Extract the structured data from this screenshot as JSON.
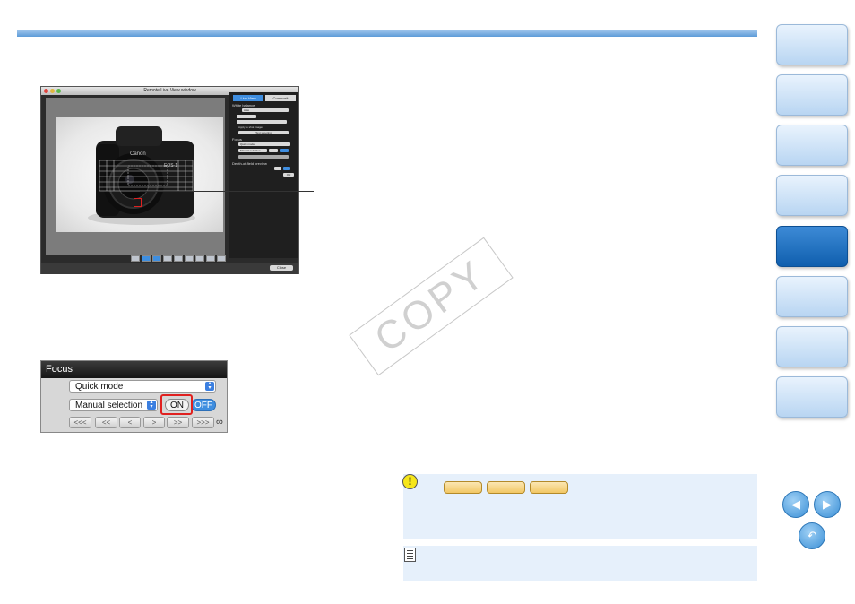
{
  "window": {
    "title": "Remote Live View window",
    "tab_live_view": "Live View",
    "tab_composition": "Composit",
    "wb_label": "White balance",
    "wb_value": "Auto",
    "apply_label": "Apply to shot images",
    "test_shooting": "Test shooting",
    "focus_label": "Focus",
    "focus_mode": "Quick mode",
    "focus_sel": "Manual selection",
    "dof_label": "Depth-of-field preview",
    "on_label": "ON",
    "close_label": "Close",
    "camera_brand": "Canon",
    "camera_model": "EOS-1"
  },
  "focus_panel": {
    "header": "Focus",
    "mode": "Quick mode",
    "selection": "Manual selection",
    "on": "ON",
    "off": "OFF",
    "steps": [
      "<<<",
      "<<",
      "<",
      ">",
      ">>",
      ">>>"
    ],
    "infinity": "∞"
  },
  "watermark": "COPY",
  "colors": {
    "accent_blue": "#3f8ee0",
    "highlight_red": "#e0201f",
    "nav_active": "#1f6fbf",
    "caution_yellow": "#f6e61a"
  },
  "icons": {
    "prev": "prev-page-icon",
    "next": "next-page-icon",
    "back": "return-icon",
    "caution": "caution-icon",
    "memo": "memo-icon"
  }
}
